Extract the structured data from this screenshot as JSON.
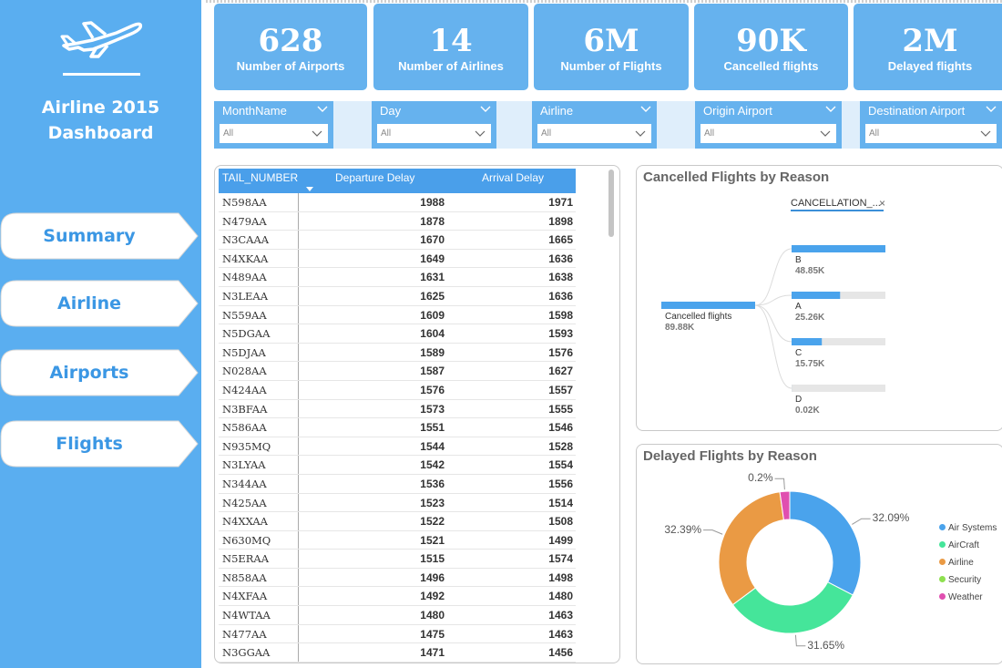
{
  "sidebar": {
    "logo_icon": "airplane-icon",
    "title_line1": "Airline 2015",
    "title_line2": "Dashboard",
    "nav": [
      {
        "label": "Summary"
      },
      {
        "label": "Airline"
      },
      {
        "label": "Airports"
      },
      {
        "label": "Flights"
      }
    ]
  },
  "kpis": [
    {
      "value": "628",
      "label": "Number of Airports"
    },
    {
      "value": "14",
      "label": "Number of Airlines"
    },
    {
      "value": "6M",
      "label": "Number of Flights"
    },
    {
      "value": "90K",
      "label": "Cancelled flights"
    },
    {
      "value": "2M",
      "label": "Delayed flights"
    }
  ],
  "filters": [
    {
      "title": "MonthName",
      "value": "All"
    },
    {
      "title": "Day",
      "value": "All"
    },
    {
      "title": "Airline",
      "value": "All"
    },
    {
      "title": "Origin Airport",
      "value": "All"
    },
    {
      "title": "Destination Airport",
      "value": "All"
    }
  ],
  "table": {
    "columns": [
      "TAIL_NUMBER",
      "Departure Delay",
      "Arrival Delay"
    ],
    "rows": [
      [
        "N598AA",
        "1988",
        "1971"
      ],
      [
        "N479AA",
        "1878",
        "1898"
      ],
      [
        "N3CAAA",
        "1670",
        "1665"
      ],
      [
        "N4XKAA",
        "1649",
        "1636"
      ],
      [
        "N489AA",
        "1631",
        "1638"
      ],
      [
        "N3LEAA",
        "1625",
        "1636"
      ],
      [
        "N559AA",
        "1609",
        "1598"
      ],
      [
        "N5DGAA",
        "1604",
        "1593"
      ],
      [
        "N5DJAA",
        "1589",
        "1576"
      ],
      [
        "N028AA",
        "1587",
        "1627"
      ],
      [
        "N424AA",
        "1576",
        "1557"
      ],
      [
        "N3BFAA",
        "1573",
        "1555"
      ],
      [
        "N586AA",
        "1551",
        "1546"
      ],
      [
        "N935MQ",
        "1544",
        "1528"
      ],
      [
        "N3LYAA",
        "1542",
        "1554"
      ],
      [
        "N344AA",
        "1536",
        "1556"
      ],
      [
        "N425AA",
        "1523",
        "1514"
      ],
      [
        "N4XXAA",
        "1522",
        "1508"
      ],
      [
        "N630MQ",
        "1521",
        "1499"
      ],
      [
        "N5ERAA",
        "1515",
        "1574"
      ],
      [
        "N858AA",
        "1496",
        "1498"
      ],
      [
        "N4XFAA",
        "1492",
        "1480"
      ],
      [
        "N4WTAA",
        "1480",
        "1463"
      ],
      [
        "N477AA",
        "1475",
        "1463"
      ],
      [
        "N3GGAA",
        "1471",
        "1456"
      ]
    ]
  },
  "cancelled_card": {
    "title": "Cancelled Flights by Reason",
    "field_header": "CANCELLATION_...",
    "root": {
      "label": "Cancelled flights",
      "value": "89.88K"
    },
    "nodes": [
      {
        "label": "B",
        "value": "48.85K",
        "amount": 48.85
      },
      {
        "label": "A",
        "value": "25.26K",
        "amount": 25.26
      },
      {
        "label": "C",
        "value": "15.75K",
        "amount": 15.75
      },
      {
        "label": "D",
        "value": "0.02K",
        "amount": 0.02
      }
    ]
  },
  "delayed_card": {
    "title": "Delayed Flights by Reason",
    "chart_data": {
      "type": "pie",
      "series": [
        {
          "name": "Air Systems",
          "value": 32.09,
          "label": "32.09%",
          "color": "#4aa3ec"
        },
        {
          "name": "AirCraft",
          "value": 31.65,
          "label": "31.65%",
          "color": "#45e59a"
        },
        {
          "name": "Airline",
          "value": 32.39,
          "label": "32.39%",
          "color": "#ea9a44"
        },
        {
          "name": "Security",
          "value": 0.01,
          "label": "",
          "color": "#8ee04f"
        },
        {
          "name": "Weather",
          "value": 2.2,
          "label": "0.2%",
          "color": "#e04fb0"
        }
      ],
      "legend_position": "right"
    }
  }
}
